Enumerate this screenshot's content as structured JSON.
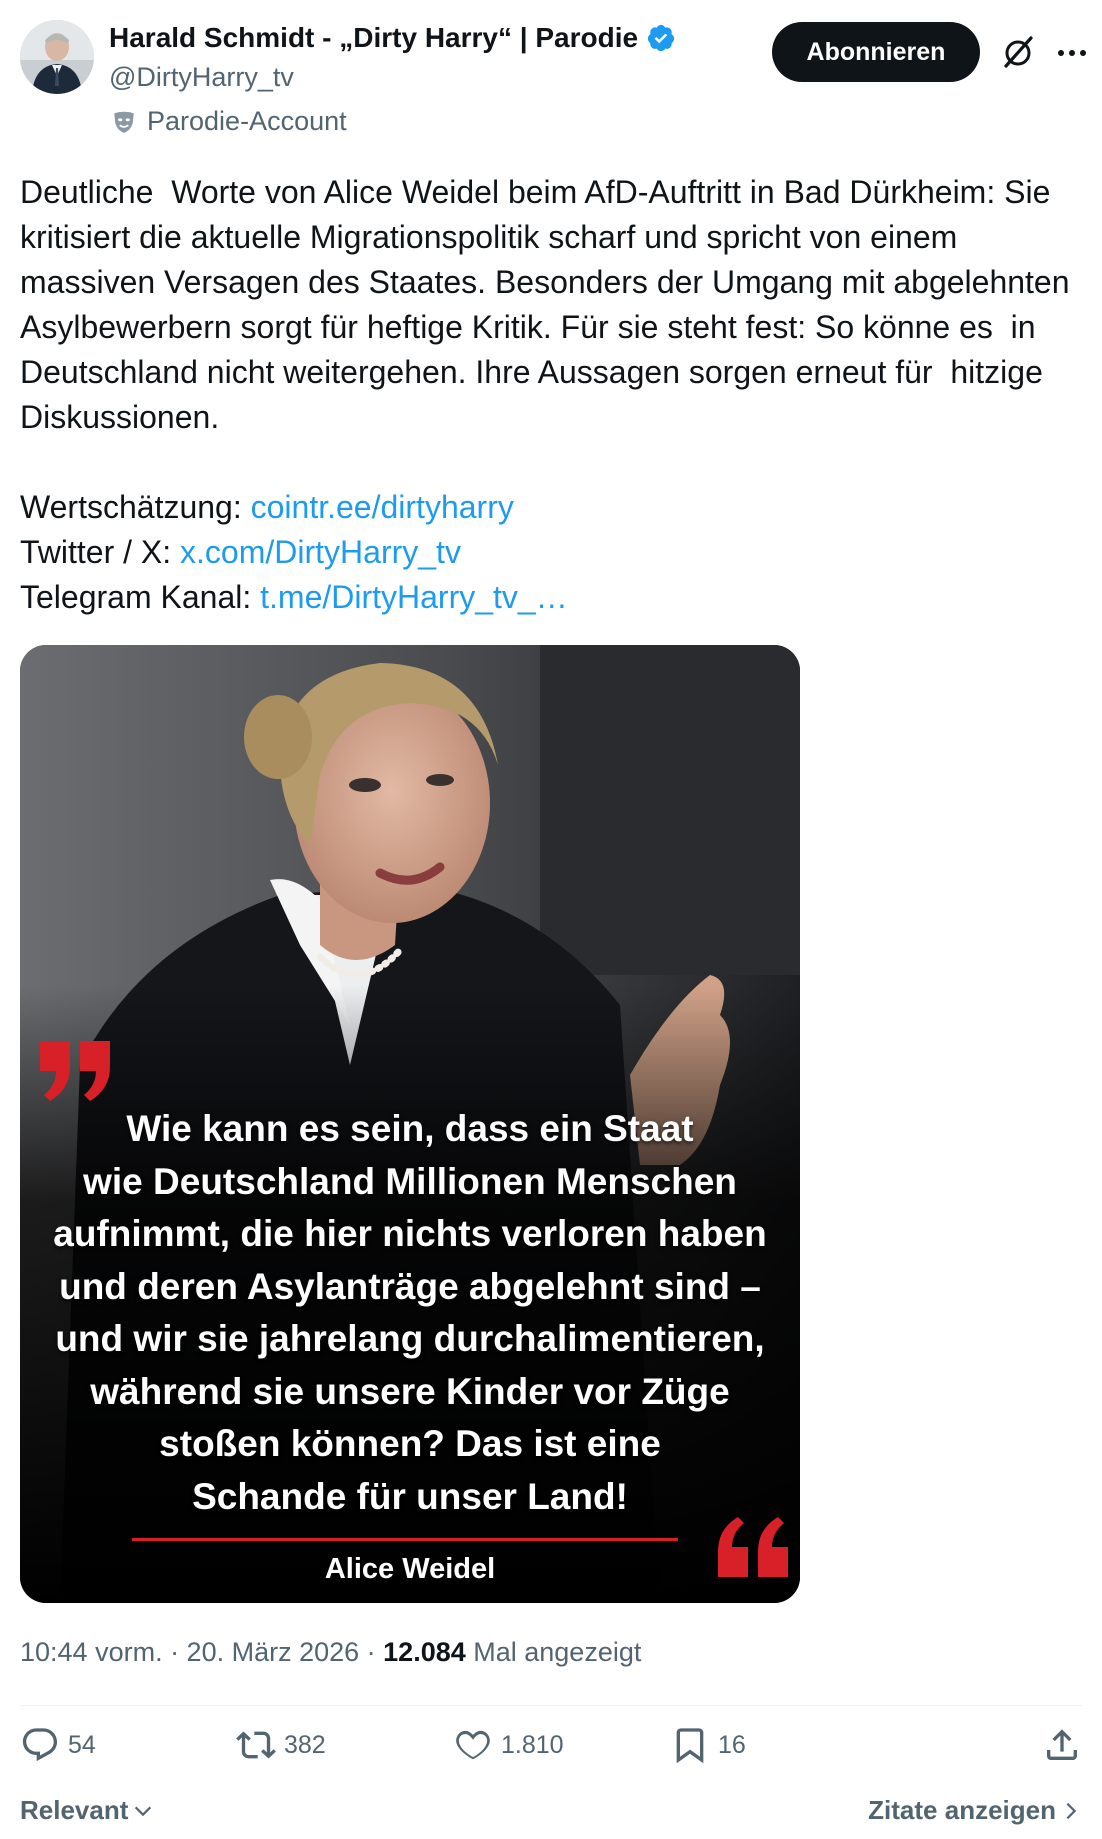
{
  "author": {
    "display_name": "Harald Schmidt - „Dirty Harry“ | Parodie",
    "handle": "@DirtyHarry_tv",
    "parody_label": "Parodie-Account",
    "verified_color": "#1d9bf0"
  },
  "header_actions": {
    "subscribe_label": "Abonnieren"
  },
  "tweet": {
    "body": "Deutliche  Worte von Alice Weidel beim AfD-Auftritt in Bad Dürkheim: Sie kritisiert die aktuelle Migrationspolitik scharf und spricht von einem massiven Versagen des Staates. Besonders der Umgang mit abgelehnten  Asylbewerbern sorgt für heftige Kritik. Für sie steht fest: So könne es  in Deutschland nicht weitergehen. Ihre Aussagen sorgen erneut für  hitzige Diskussionen.",
    "links": [
      {
        "label": "Wertschätzung: ",
        "link_text": "cointr.ee/dirtyharry"
      },
      {
        "label": "Twitter / X: ",
        "link_text": "x.com/DirtyHarry_tv"
      },
      {
        "label": "Telegram Kanal: ",
        "link_text": "t.me/DirtyHarry_tv_…"
      }
    ],
    "link_color": "#1d9bf0"
  },
  "media": {
    "quote_lines": [
      "Wie kann es sein, dass ein Staat",
      "wie Deutschland Millionen Menschen",
      "aufnimmt, die hier nichts verloren haben",
      "und deren Asylanträge abgelehnt sind –",
      "und wir sie jahrelang durchalimentieren,",
      "während sie unsere Kinder vor Züge",
      "stoßen können? Das ist eine",
      "Schande für unser Land!"
    ],
    "author": "Alice Weidel",
    "accent_color": "#d72027"
  },
  "meta": {
    "time_date": "10:44 vorm. · 20. März 2026 · ",
    "views": "12.084",
    "views_suffix": " Mal angezeigt"
  },
  "stats": {
    "replies": "54",
    "reposts": "382",
    "likes": "1.810",
    "bookmarks": "16"
  },
  "footer": {
    "sort_label": "Relevant",
    "quotes_label": "Zitate anzeigen"
  }
}
